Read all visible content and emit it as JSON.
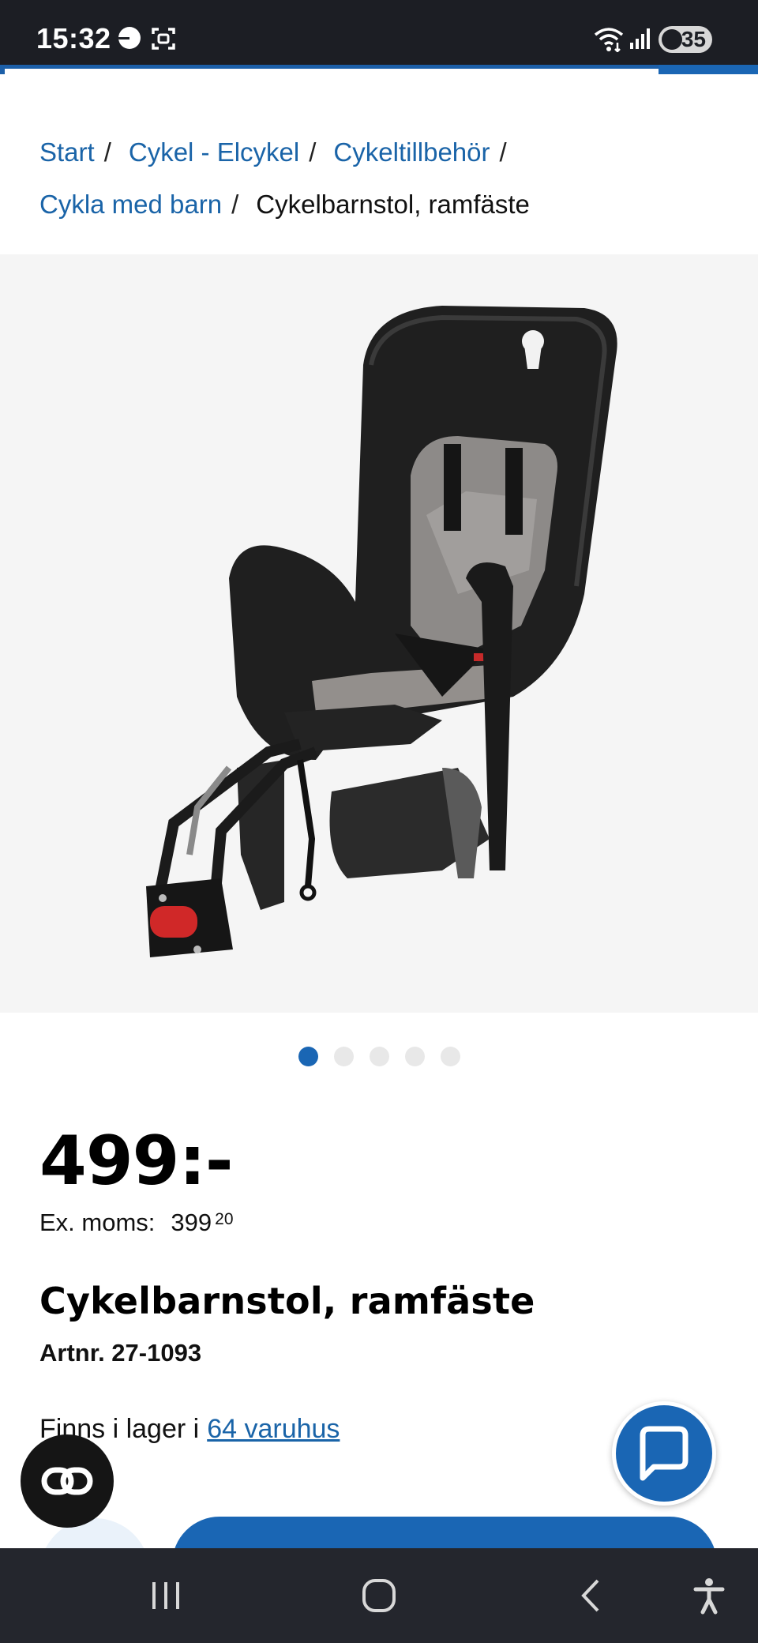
{
  "status_bar": {
    "time": "15:32",
    "battery": "35",
    "icons": [
      "do-not-disturb-icon",
      "screenshot-icon",
      "wifi-icon",
      "signal-icon",
      "battery-icon"
    ]
  },
  "breadcrumb": {
    "items": [
      {
        "label": "Start",
        "link": true
      },
      {
        "label": "Cykel - Elcykel",
        "link": true
      },
      {
        "label": "Cykeltillbehör",
        "link": true
      },
      {
        "label": "Cykla med barn",
        "link": true
      },
      {
        "label": "Cykelbarnstol, ramfäste",
        "link": false
      }
    ],
    "separator": "/"
  },
  "gallery": {
    "image_subject": "child-bike-seat-image",
    "dot_count": 5,
    "active_index": 0
  },
  "product": {
    "price": "499:-",
    "ex_moms_label": "Ex. moms:",
    "ex_moms_value": "399",
    "ex_moms_decimals": "20",
    "title": "Cykelbarnstol, ramfäste",
    "article_number": "Artnr. 27-1093",
    "stock_text": "Finns i lager i",
    "stock_link": "64 varuhus"
  },
  "colors": {
    "accent": "#1a66b4",
    "link": "#1a64a8",
    "status_bar": "#1c1e24",
    "nav_bar": "#24262d"
  },
  "nav": {
    "items": [
      "recent-apps-icon",
      "home-icon",
      "back-icon",
      "accessibility-icon"
    ]
  }
}
